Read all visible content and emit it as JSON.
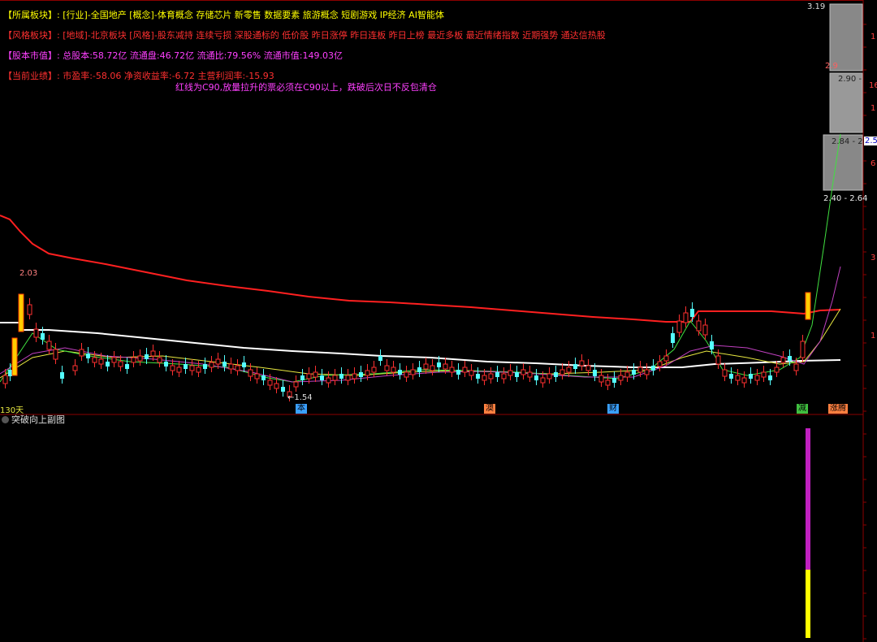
{
  "info": {
    "sector_label": "【所属板块】:",
    "sector_value": "[行业]-全国地产 [概念]-体育概念 存储芯片 新零售 数据要素 旅游概念 短剧游戏 IP经济 AI智能体",
    "style_label": "【风格板块】:",
    "style_value": "[地域]-北京板块 [风格]-股东减持 连续亏损 深股通标的 低价股 昨日涨停 昨日连板 昨日上榜 最近多板 最近情绪指数 近期强势 通达信热股",
    "cap_label": "【股本市值】:",
    "cap_value": "总股本:58.72亿 流通盘:46.72亿 流通比:79.56% 流通市值:149.03亿",
    "perf_label": "【当前业绩】:",
    "perf_value": "市盈率:-58.06 净资收益率:-6.72 主营利润率:-15.93",
    "note": "红线为C90,放量拉升的票必须在C90以上，跌破后次日不反包清仓"
  },
  "price_labels": {
    "high": "2.03",
    "low": "←1.54",
    "period": "130天"
  },
  "right_axis": {
    "top": "3.19",
    "mid1": "2.9",
    "mid1_box": "2.90 -",
    "current": "2.84 - 2.",
    "current_tag": "2.5",
    "low_box": "2.40 - 2.64",
    "ticks": [
      "1",
      "16",
      "1",
      "6",
      "3",
      "1"
    ]
  },
  "event_tags": [
    {
      "text": "本",
      "color": "#3aa0ff"
    },
    {
      "text": "澳",
      "color": "#ff8040"
    },
    {
      "text": "财",
      "color": "#3aa0ff"
    },
    {
      "text": "减",
      "color": "#40c040"
    },
    {
      "text": "涨腾",
      "color": "#ff8040"
    }
  ],
  "sub_chart": {
    "title": "突破向上副图"
  },
  "colors": {
    "up": "#ff3030",
    "down": "#54ffff",
    "ma_red": "#ff2020",
    "ma_white": "#ffffff",
    "magenta": "#d020d0",
    "yellow": "#ffff00"
  }
}
